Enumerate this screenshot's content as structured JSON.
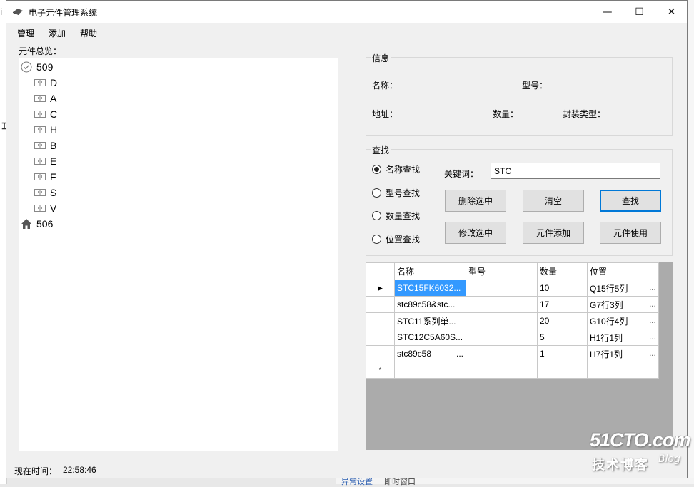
{
  "window": {
    "title": "电子元件管理系统",
    "controls": {
      "minimize": "—",
      "maximize": "☐",
      "close": "✕"
    }
  },
  "menu": [
    "管理",
    "添加",
    "帮助"
  ],
  "overview": {
    "label": "元件总览：",
    "tree": [
      {
        "label": "509",
        "icon": "check-circle-icon",
        "children": [
          "D",
          "A",
          "C",
          "H",
          "B",
          "E",
          "F",
          "S",
          "V"
        ]
      },
      {
        "label": "506",
        "icon": "house-icon",
        "children": []
      }
    ]
  },
  "info": {
    "title": "信息",
    "name_label": "名称：",
    "model_label": "型号：",
    "address_label": "地址：",
    "quantity_label": "数量：",
    "package_label": "封装类型："
  },
  "search": {
    "title": "查找",
    "radios": [
      {
        "label": "名称查找",
        "checked": true
      },
      {
        "label": "型号查找",
        "checked": false
      },
      {
        "label": "数量查找",
        "checked": false
      },
      {
        "label": "位置查找",
        "checked": false
      }
    ],
    "keyword_label": "关键词：",
    "keyword_value": "STC",
    "buttons": {
      "delete_selected": "删除选中",
      "clear": "清空",
      "find": "查找",
      "edit_selected": "修改选中",
      "add_component": "元件添加",
      "use_component": "元件使用"
    }
  },
  "grid": {
    "columns": [
      "名称",
      "型号",
      "数量",
      "位置"
    ],
    "rows": [
      {
        "name": "STC15FK6032...",
        "model": "",
        "quantity": "10",
        "location": "Q15行5列",
        "location_more": "...",
        "selected": true
      },
      {
        "name": "stc89c58&stc...",
        "model": "",
        "quantity": "17",
        "location": "G7行3列",
        "location_more": "..."
      },
      {
        "name": "STC11系列单...",
        "model": "",
        "quantity": "20",
        "location": "G10行4列",
        "location_more": "..."
      },
      {
        "name": "STC12C5A60S...",
        "model": "",
        "quantity": "5",
        "location": "H1行1列",
        "location_more": "..."
      },
      {
        "name": "stc89c58",
        "name_more": "...",
        "model": "",
        "quantity": "1",
        "location": "H7行1列",
        "location_more": "..."
      }
    ],
    "new_row_marker": "*",
    "current_row_marker": "▶"
  },
  "status": {
    "label": "现在时间：",
    "time": "22:58:46"
  },
  "watermark": {
    "brand": "51CTO.com",
    "sub": "技术博客",
    "blog": "Blog"
  },
  "background": {
    "bottom_link": "异常设置",
    "bottom_text": "即时窗口"
  },
  "colors": {
    "selection": "#3399ff",
    "focus_border": "#0078d7",
    "window_bg": "#f0f0f0"
  }
}
